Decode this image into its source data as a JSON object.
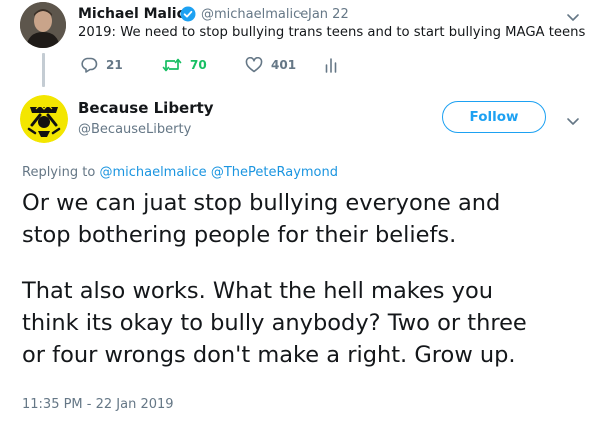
{
  "parent_tweet": {
    "author_name": "Michael Malice",
    "verified": true,
    "handle": "@michaelmalice",
    "separator": "·",
    "date": "Jan 22",
    "text": "2019: We need to stop bullying trans teens and to start bullying MAGA teens",
    "actions": {
      "replies": "21",
      "retweets": "70",
      "likes": "401"
    }
  },
  "main_tweet": {
    "author_name": "Because Liberty",
    "handle": "@BecauseLiberty",
    "follow_label": "Follow",
    "replying_prefix": "Replying to",
    "replying_to": [
      "@michaelmalice",
      "@ThePeteRaymond"
    ],
    "body_paragraphs": [
      [
        "Or we can juat stop bullying everyone and",
        "stop bothering people for their beliefs."
      ],
      [
        "That also works. What the hell makes you",
        "think its okay to bully anybody? Two or three",
        "or four wrongs don't make a right. Grow up."
      ]
    ],
    "timestamp": "11:35 PM - 22 Jan 2019"
  },
  "colors": {
    "accent": "#1da1f2",
    "retweet_active": "#17bf63",
    "secondary_text": "#657786",
    "avatar_yellow": "#f3e600"
  }
}
